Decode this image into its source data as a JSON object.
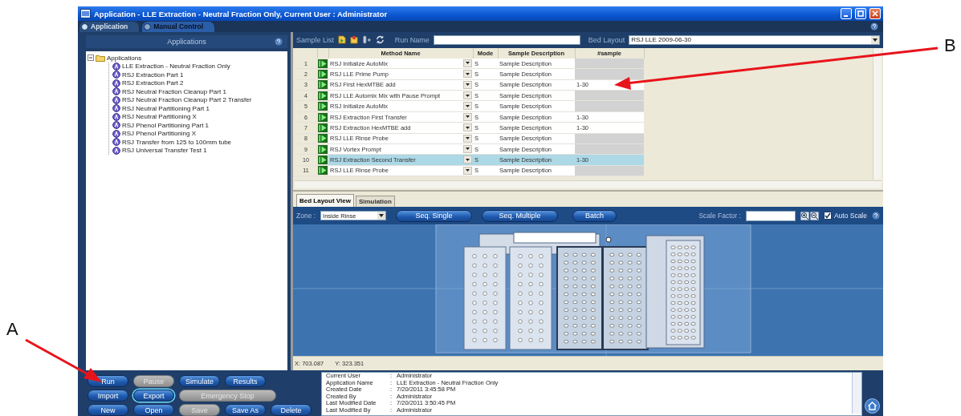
{
  "annotations": [
    {
      "label": "A"
    },
    {
      "label": "B"
    }
  ],
  "window": {
    "title": "Application - LLE Extraction - Neutral Fraction Only, Current User : Administrator"
  },
  "mode_tabs": [
    {
      "label": "Application",
      "selected": true
    },
    {
      "label": "Manual Control",
      "selected": false
    }
  ],
  "applications_panel": {
    "title": "Applications",
    "tree": [
      {
        "label": "Applications",
        "expanded": true,
        "children": [
          {
            "label": "LLE Extraction - Neutral Fraction Only"
          },
          {
            "label": "RSJ Extraction Part 1"
          },
          {
            "label": "RSJ Extraction Part 2"
          },
          {
            "label": "RSJ Neutral Fraction Cleanup Part 1"
          },
          {
            "label": "RSJ Neutral Fraction Cleanup Part 2 Transfer"
          },
          {
            "label": "RSJ Neutral Partitioning Part 1"
          },
          {
            "label": "RSJ Neutral Partitioning X"
          },
          {
            "label": "RSJ Phenol Partitioning Part 1"
          },
          {
            "label": "RSJ Phenol Partitioning X"
          },
          {
            "label": "RSJ Transfer from 125 to 100mm tube"
          },
          {
            "label": "RSJ Universal Transfer Test 1"
          }
        ]
      }
    ]
  },
  "sample_list": {
    "label": "Sample List",
    "run_name_label": "Run Name",
    "bed_layout_label": "Bed Layout",
    "bed_layout": "RSJ LLE 2009-06-30"
  },
  "table": {
    "columns": [
      "Method Name",
      "Mode",
      "Sample Description",
      "#sample"
    ],
    "rows": [
      {
        "number": "1",
        "method": "RSJ Initialize AutoMix",
        "mode": "S",
        "description": "Sample Description",
        "selected": false
      },
      {
        "number": "2",
        "method": "RSJ LLE Prime Pump",
        "mode": "S",
        "description": "Sample Description",
        "selected": false
      },
      {
        "number": "3",
        "method": "RSJ First HexMTBE add",
        "mode": "S",
        "description": "Sample Description",
        "samples": "1-30",
        "selected": false
      },
      {
        "number": "4",
        "method": "RSJ LLE Automix Mix with Pause Prompt",
        "mode": "S",
        "description": "Sample Description",
        "selected": false
      },
      {
        "number": "5",
        "method": "RSJ Initialize AutoMix",
        "mode": "S",
        "description": "Sample Description",
        "selected": false
      },
      {
        "number": "6",
        "method": "RSJ Extraction First Transfer",
        "mode": "S",
        "description": "Sample Description",
        "samples": "1-30",
        "selected": false
      },
      {
        "number": "7",
        "method": "RSJ Extraction HexMTBE add",
        "mode": "S",
        "description": "Sample Description",
        "samples": "1-30",
        "selected": false
      },
      {
        "number": "8",
        "method": "RSJ LLE Rinse Probe",
        "mode": "S",
        "description": "Sample Description",
        "selected": false
      },
      {
        "number": "9",
        "method": "RSJ Vortex Prompt",
        "mode": "S",
        "description": "Sample Description",
        "selected": false
      },
      {
        "number": "10",
        "method": "RSJ Extraction Second Transfer",
        "mode": "S",
        "description": "Sample Description",
        "samples": "1-30",
        "selected": true
      },
      {
        "number": "11",
        "method": "RSJ LLE Rinse Probe",
        "mode": "S",
        "description": "Sample Description",
        "selected": false
      }
    ]
  },
  "view_tabs": [
    {
      "label": "Bed Layout View",
      "selected": true
    },
    {
      "label": "Simulation",
      "selected": false
    }
  ],
  "bed_toolbar": {
    "zone_label": "Zone :",
    "zone": "Inside Rinse",
    "buttons": [
      "Seq. Single",
      "Seq. Multiple",
      "Batch"
    ],
    "scale_factor_label": "Scale Factor :",
    "auto_scale": {
      "label": "Auto Scale",
      "checked": true
    }
  },
  "coordinates": {
    "x": "X: 703.087",
    "y": "Y: 323.351"
  },
  "buttons": [
    [
      {
        "label": "Run",
        "disabled": false,
        "focused": false
      },
      {
        "label": "Pause",
        "disabled": true,
        "focused": false
      },
      {
        "label": "Simulate",
        "disabled": false,
        "focused": false
      },
      {
        "label": "Results",
        "disabled": false,
        "focused": false
      }
    ],
    [
      {
        "label": "Import",
        "disabled": false,
        "focused": false
      },
      {
        "label": "Export",
        "disabled": false,
        "focused": true
      },
      {
        "label": "Emergency Stop",
        "disabled": true,
        "focused": false
      }
    ],
    [
      {
        "label": "New",
        "disabled": false,
        "focused": false
      },
      {
        "label": "Open",
        "disabled": false,
        "focused": false
      },
      {
        "label": "Save",
        "disabled": true,
        "focused": false
      },
      {
        "label": "Save As",
        "disabled": false,
        "focused": false
      },
      {
        "label": "Delete",
        "disabled": false,
        "focused": false
      }
    ]
  ],
  "info": [
    {
      "key": "Current User",
      "separator": ":",
      "value": "Administrator"
    },
    {
      "key": "Application Name",
      "separator": ":",
      "value": "LLE Extraction - Neutral Fraction Only"
    },
    {
      "key": "Created Date",
      "separator": ":",
      "value": "7/20/2011 3:45:58 PM"
    },
    {
      "key": "Created By",
      "separator": ":",
      "value": "Administrator"
    },
    {
      "key": "Last Modified Date",
      "separator": ":",
      "value": "7/20/2011 3:50:45 PM"
    },
    {
      "key": "Last Modified By",
      "separator": ":",
      "value": "Administrator"
    }
  ]
}
